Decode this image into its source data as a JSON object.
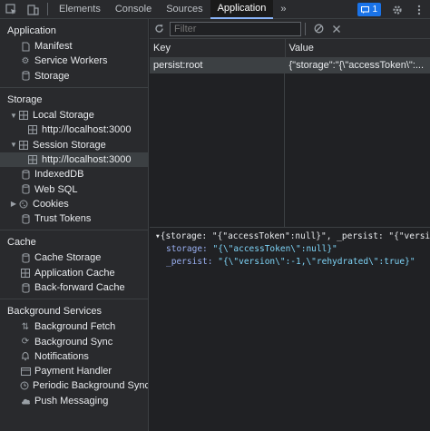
{
  "tabs": [
    {
      "label": "Elements"
    },
    {
      "label": "Console"
    },
    {
      "label": "Sources"
    },
    {
      "label": "Application"
    }
  ],
  "top": {
    "more_icon": "»",
    "issues_count": "1"
  },
  "sidebar": {
    "application": {
      "title": "Application",
      "items": [
        {
          "label": "Manifest",
          "icon": "file-icon"
        },
        {
          "label": "Service Workers",
          "icon": "gear-icon"
        },
        {
          "label": "Storage",
          "icon": "database-icon"
        }
      ]
    },
    "storage": {
      "title": "Storage",
      "local_storage": "Local Storage",
      "local_origin": "http://localhost:3000",
      "session_storage": "Session Storage",
      "session_origin": "http://localhost:3000",
      "indexeddb": "IndexedDB",
      "websql": "Web SQL",
      "cookies": "Cookies",
      "trust_tokens": "Trust Tokens"
    },
    "cache": {
      "title": "Cache",
      "items": [
        {
          "label": "Cache Storage"
        },
        {
          "label": "Application Cache"
        },
        {
          "label": "Back-forward Cache"
        }
      ]
    },
    "background": {
      "title": "Background Services",
      "items": [
        {
          "label": "Background Fetch"
        },
        {
          "label": "Background Sync"
        },
        {
          "label": "Notifications"
        },
        {
          "label": "Payment Handler"
        },
        {
          "label": "Periodic Background Sync"
        },
        {
          "label": "Push Messaging"
        }
      ]
    }
  },
  "main": {
    "filter_placeholder": "Filter",
    "columns": {
      "key": "Key",
      "value": "Value"
    },
    "rows": [
      {
        "key": "persist:root",
        "value": "{\"storage\":\"{\\\"accessToken\\\":..."
      }
    ],
    "preview": {
      "line1": "▾{storage: \"{\"accessToken\":null}\", _persist: \"{\"version\"",
      "storage_key": "storage:",
      "storage_val": "\"{\\\"accessToken\\\":null}\"",
      "persist_key": "_persist:",
      "persist_val": "\"{\\\"version\\\":-1,\\\"rehydrated\\\":true}\""
    }
  },
  "colors": {
    "accent": "#8ab4f8",
    "background": "#202124",
    "sidebar": "#292a2d",
    "selection": "#3c4043"
  }
}
